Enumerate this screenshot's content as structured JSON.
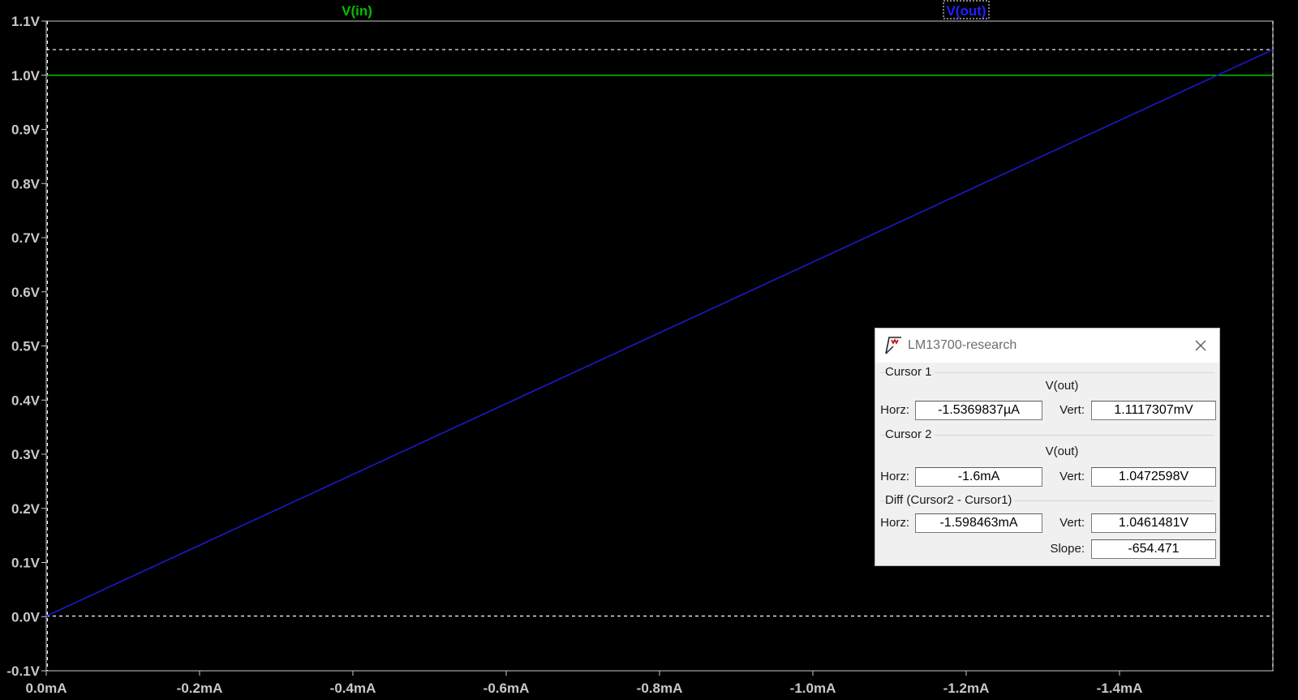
{
  "chart_data": {
    "type": "line",
    "x_unit": "mA",
    "x_direction": "reversed (0 at left, negative to the right)",
    "xlim": [
      0.0,
      -1.6
    ],
    "ylim": [
      -0.1,
      1.1
    ],
    "x_ticks": [
      "0.0mA",
      "-0.2mA",
      "-0.4mA",
      "-0.6mA",
      "-0.8mA",
      "-1.0mA",
      "-1.2mA",
      "-1.4mA"
    ],
    "x_tick_values": [
      0.0,
      -0.2,
      -0.4,
      -0.6,
      -0.8,
      -1.0,
      -1.2,
      -1.4
    ],
    "y_ticks": [
      "1.1V",
      "1.0V",
      "0.9V",
      "0.8V",
      "0.7V",
      "0.6V",
      "0.5V",
      "0.4V",
      "0.3V",
      "0.2V",
      "0.1V",
      "0.0V",
      "-0.1V"
    ],
    "y_tick_values": [
      1.1,
      1.0,
      0.9,
      0.8,
      0.7,
      0.6,
      0.5,
      0.4,
      0.3,
      0.2,
      0.1,
      0.0,
      -0.1
    ],
    "grid": false,
    "background": "#000000",
    "axis_color": "#c8c8c8",
    "series": [
      {
        "name": "V(in)",
        "color": "#00c000",
        "x": [
          0.0,
          -1.6
        ],
        "y": [
          1.0,
          1.0
        ]
      },
      {
        "name": "V(out)",
        "color": "#1a1acc",
        "x": [
          0.0,
          -1.6
        ],
        "y": [
          0.0011117,
          1.0472598
        ]
      }
    ],
    "cursor_lines": [
      {
        "name": "Cursor 1",
        "y": 0.0011117,
        "x": -0.0015369837
      },
      {
        "name": "Cursor 2",
        "y": 1.0472598,
        "x": -1.6
      }
    ]
  },
  "cursor_dialog": {
    "title": "LM13700-research",
    "cursor1": {
      "label": "Cursor 1",
      "trace": "V(out)",
      "horz_label": "Horz:",
      "horz": "-1.5369837µA",
      "vert_label": "Vert:",
      "vert": "1.1117307mV"
    },
    "cursor2": {
      "label": "Cursor 2",
      "trace": "V(out)",
      "horz_label": "Horz:",
      "horz": "-1.6mA",
      "vert_label": "Vert:",
      "vert": "1.0472598V"
    },
    "diff": {
      "label": "Diff (Cursor2 - Cursor1)",
      "horz_label": "Horz:",
      "horz": "-1.598463mA",
      "vert_label": "Vert:",
      "vert": "1.0461481V",
      "slope_label": "Slope:",
      "slope": "-654.471"
    }
  }
}
